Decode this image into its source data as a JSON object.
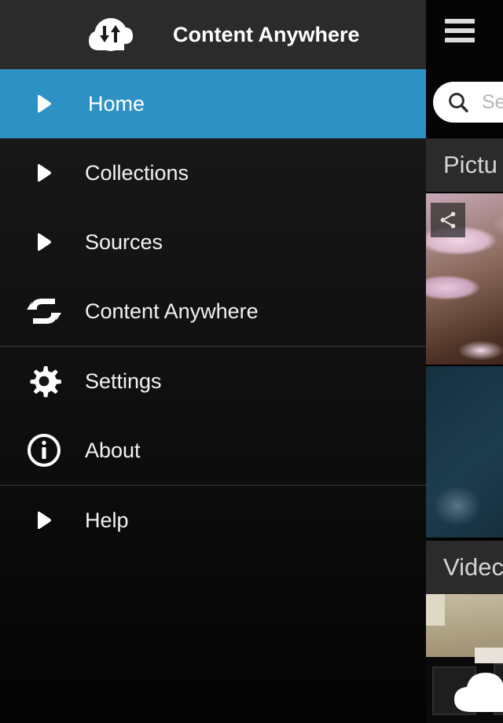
{
  "app": {
    "title": "Content Anywhere",
    "accent_color": "#2e91c4",
    "header_bg": "#2b2b2b",
    "drawer_bg": "#151515",
    "logo_icon": "cloud-sync-icon"
  },
  "drawer": {
    "header": {
      "icon": "cloud-up-down-arrows-icon",
      "title": "Content Anywhere"
    },
    "items": [
      {
        "id": "home",
        "label": "Home",
        "icon": "play-arrow-icon",
        "active": true
      },
      {
        "id": "collections",
        "label": "Collections",
        "icon": "play-arrow-icon",
        "active": false
      },
      {
        "id": "sources",
        "label": "Sources",
        "icon": "play-arrow-icon",
        "active": false
      },
      {
        "id": "content-anywhere",
        "label": "Content Anywhere",
        "icon": "sync-arrows-icon",
        "active": false
      },
      {
        "id": "settings",
        "label": "Settings",
        "icon": "gear-icon",
        "active": false
      },
      {
        "id": "about",
        "label": "About",
        "icon": "info-circle-icon",
        "active": false
      },
      {
        "id": "help",
        "label": "Help",
        "icon": "play-arrow-icon",
        "active": false
      }
    ]
  },
  "content": {
    "menu_button_icon": "hamburger-menu-icon",
    "search": {
      "icon": "search-icon",
      "placeholder": "Se",
      "value": ""
    },
    "sections": [
      {
        "id": "pictures",
        "title": "Pictu"
      },
      {
        "id": "videos",
        "title": "Videc"
      }
    ],
    "thumbnails": [
      {
        "id": "thumb-1",
        "section": "pictures",
        "overlay_icon": "share-icon",
        "description": "anemone"
      },
      {
        "id": "thumb-2",
        "section": "pictures",
        "overlay_icon": "",
        "description": "jellyfish"
      },
      {
        "id": "thumb-3",
        "section": "videos",
        "overlay_icon": "",
        "description": "room wall"
      },
      {
        "id": "thumb-4",
        "section": "videos",
        "overlay_icon": "",
        "description": "dark room"
      }
    ],
    "fab": {
      "icon": "cloud-icon",
      "label": ""
    }
  }
}
